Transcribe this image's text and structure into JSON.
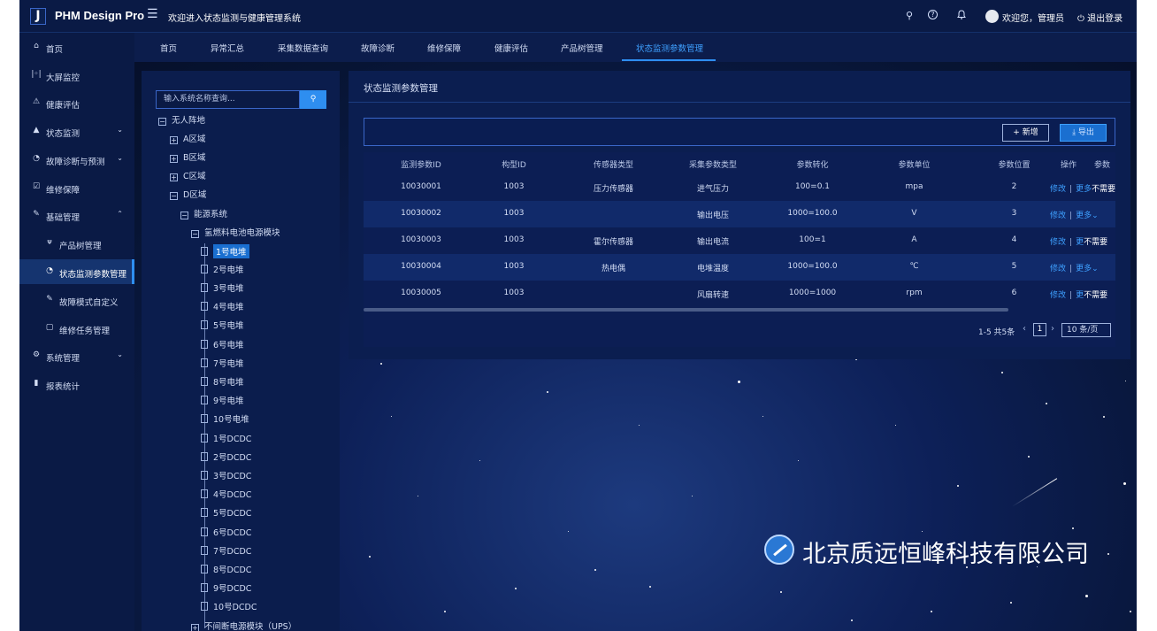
{
  "app": {
    "logo_letter": "J",
    "title": "PHM Design Pro",
    "welcome_system": "欢迎进入状态监测与健康管理系统"
  },
  "topbar": {
    "menu_icon": "☰",
    "search_icon": "⚲",
    "help_icon": "?",
    "bell_icon": "bell",
    "greeting": "欢迎您，管理员",
    "logout": "退出登录"
  },
  "sidebar": {
    "items": [
      {
        "label": "首页",
        "icon": "⌂"
      },
      {
        "label": "大屏监控",
        "icon": "|◦|"
      },
      {
        "label": "健康评估",
        "icon": "⚠"
      },
      {
        "label": "状态监测",
        "icon": "▲",
        "arrow": "⌄"
      },
      {
        "label": "故障诊断与预测",
        "icon": "◔",
        "arrow": "⌄"
      },
      {
        "label": "维修保障",
        "icon": "☑"
      },
      {
        "label": "基础管理",
        "icon": "✎",
        "arrow": "⌃"
      },
      {
        "label": "产品树管理",
        "icon": "ᴪ"
      },
      {
        "label": "状态监测参数管理",
        "icon": "◔"
      },
      {
        "label": "故障模式自定义",
        "icon": "✎"
      },
      {
        "label": "维修任务管理",
        "icon": "▢"
      },
      {
        "label": "系统管理",
        "icon": "⚙",
        "arrow": "⌄"
      },
      {
        "label": "报表统计",
        "icon": "▮"
      }
    ]
  },
  "tabs": [
    "首页",
    "异常汇总",
    "采集数据查询",
    "故障诊断",
    "维修保障",
    "健康评估",
    "产品树管理",
    "状态监测参数管理"
  ],
  "tree": {
    "search_placeholder": "输入系统名称查询...",
    "search_icon": "⚲",
    "nodes": [
      {
        "label": "无人阵地",
        "expander": "−"
      },
      {
        "label": "A区域",
        "expander": "+"
      },
      {
        "label": "B区域",
        "expander": "+"
      },
      {
        "label": "C区域",
        "expander": "+"
      },
      {
        "label": "D区域",
        "expander": "−"
      },
      {
        "label": "能源系统",
        "expander": "−"
      },
      {
        "label": "氢燃料电池电源模块",
        "expander": "−"
      },
      {
        "label": "1号电堆"
      },
      {
        "label": "2号电堆"
      },
      {
        "label": "3号电堆"
      },
      {
        "label": "4号电堆"
      },
      {
        "label": "5号电堆"
      },
      {
        "label": "6号电堆"
      },
      {
        "label": "7号电堆"
      },
      {
        "label": "8号电堆"
      },
      {
        "label": "9号电堆"
      },
      {
        "label": "10号电堆"
      },
      {
        "label": "1号DCDC"
      },
      {
        "label": "2号DCDC"
      },
      {
        "label": "3号DCDC"
      },
      {
        "label": "4号DCDC"
      },
      {
        "label": "5号DCDC"
      },
      {
        "label": "6号DCDC"
      },
      {
        "label": "7号DCDC"
      },
      {
        "label": "8号DCDC"
      },
      {
        "label": "9号DCDC"
      },
      {
        "label": "10号DCDC"
      },
      {
        "label": "不间断电源模块（UPS）",
        "expander": "+"
      }
    ]
  },
  "main": {
    "title": "状态监测参数管理",
    "add_button": "+ 新增",
    "export_button": "⤓ 导出",
    "columns": [
      "监测参数ID",
      "构型ID",
      "传感器类型",
      "采集参数类型",
      "参数转化",
      "参数单位",
      "参数位置",
      "操作",
      "参数"
    ],
    "rows": [
      [
        "10030001",
        "1003",
        "压力传感器",
        "进气压力",
        "100=0.1",
        "mpa",
        "2"
      ],
      [
        "10030002",
        "1003",
        "",
        "输出电压",
        "1000=100.0",
        "V",
        "3"
      ],
      [
        "10030003",
        "1003",
        "霍尔传感器",
        "输出电流",
        "100=1",
        "A",
        "4"
      ],
      [
        "10030004",
        "1003",
        "热电偶",
        "电堆温度",
        "1000=100.0",
        "℃",
        "5"
      ],
      [
        "10030005",
        "1003",
        "",
        "风扇转速",
        "1000=1000",
        "rpm",
        "6"
      ]
    ],
    "row_ops": [
      {
        "edit": "修改",
        "sep": "|",
        "more": "更多",
        "extra": "不需要"
      },
      {
        "edit": "修改",
        "sep": "|",
        "more": "更多",
        "extra": "⌄"
      },
      {
        "edit": "修改",
        "sep": "|",
        "more": "更",
        "extra": "不需要"
      },
      {
        "edit": "修改",
        "sep": "|",
        "more": "更多",
        "extra": "⌄"
      },
      {
        "edit": "修改",
        "sep": "|",
        "more": "更",
        "extra": "不需要"
      }
    ],
    "pagination": {
      "summary": "1-5 共5条",
      "prev": "‹",
      "page": "1",
      "next": "›",
      "page_size": "10 条/页"
    }
  },
  "watermark": {
    "text": "北京质远恒峰科技有限公司"
  },
  "colors": {
    "accent": "#2e8ef0",
    "link": "#3ea0ff",
    "panel": "#0b1e50",
    "sidebar": "#0a1a45"
  }
}
